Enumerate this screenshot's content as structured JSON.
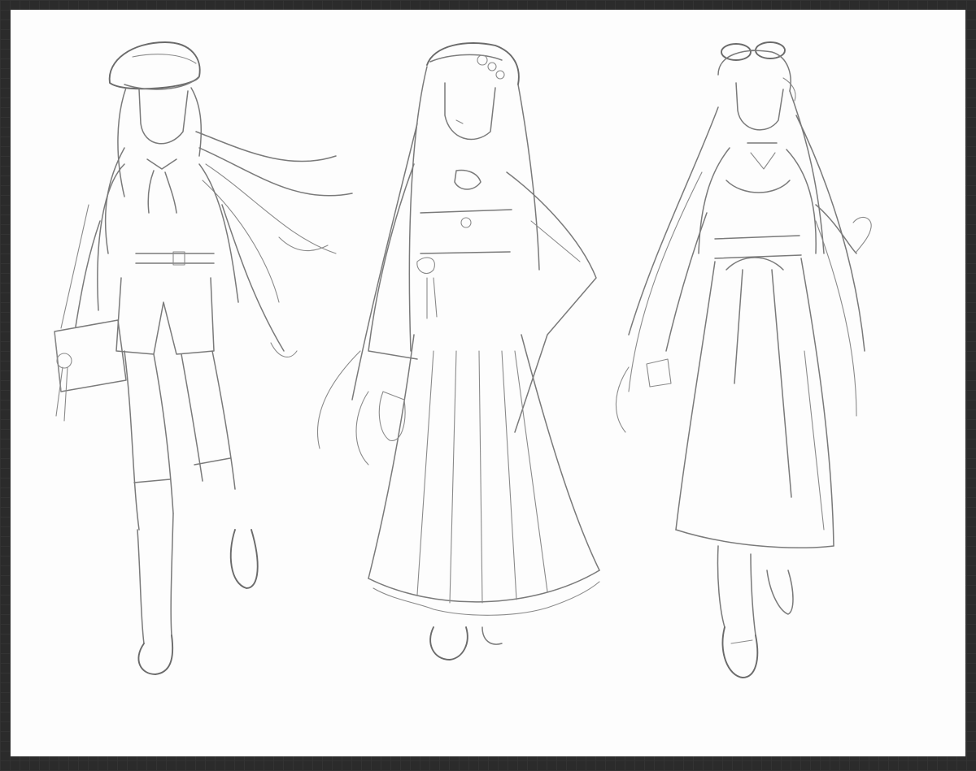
{
  "canvas": {
    "background_color": "#2b2b2b",
    "paper_color": "#fdfdfd",
    "line_color": "#7a7a7a"
  },
  "figures": [
    {
      "id": "figure-left",
      "outfit": "cap-jacket-shorts-knee-socks",
      "accessory": "shoulder-bag"
    },
    {
      "id": "figure-center",
      "outfit": "kimono-hakama",
      "accessory": "flower-headband"
    },
    {
      "id": "figure-right",
      "outfit": "high-waist-skirt-sash-bow",
      "accessory": "sunglasses-on-head"
    }
  ]
}
